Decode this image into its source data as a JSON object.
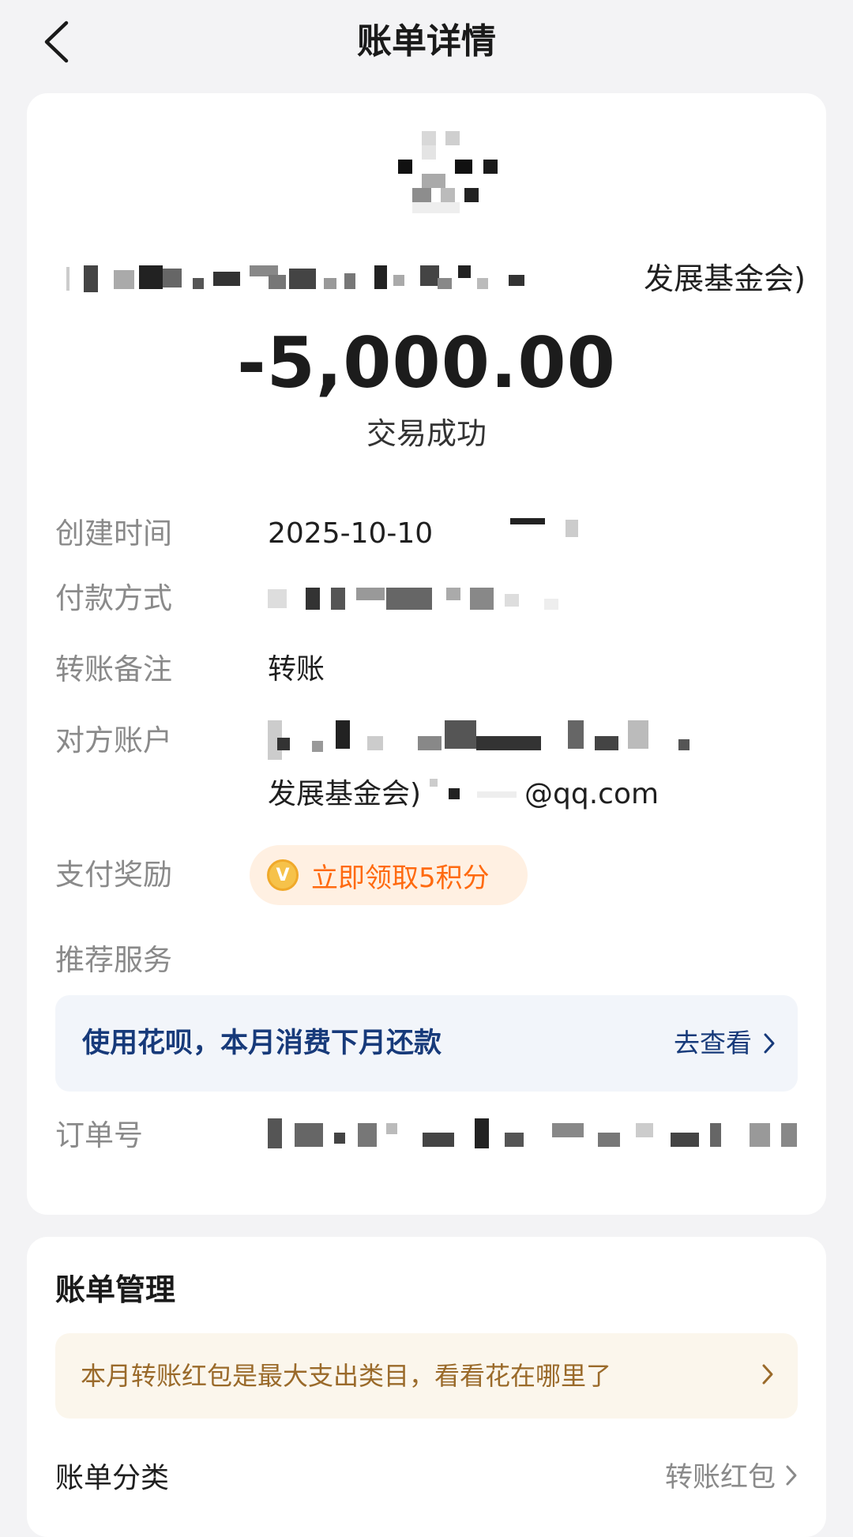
{
  "nav": {
    "back_icon": "chevron-left-icon",
    "title": "账单详情"
  },
  "header": {
    "merchant_visible_tail": "发展基金会)",
    "amount": "-5,000.00",
    "status": "交易成功"
  },
  "details": {
    "created_time": {
      "label": "创建时间",
      "value": "2025-10-10"
    },
    "payment_method": {
      "label": "付款方式"
    },
    "remark": {
      "label": "转账备注",
      "value": "转账"
    },
    "counterparty": {
      "label": "对方账户",
      "value_line2_start": "发展基金会)",
      "value_line2_end": "@qq.com"
    },
    "reward": {
      "label": "支付奖励",
      "button": "立即领取5积分",
      "coin_symbol": "V"
    },
    "recommend": {
      "label": "推荐服务"
    },
    "order_no": {
      "label": "订单号"
    }
  },
  "promo": {
    "text": "使用花呗，本月消费下月还款",
    "link": "去查看"
  },
  "manage": {
    "title": "账单管理",
    "tip": "本月转账红包是最大支出类目，看看花在哪里了",
    "category_label": "账单分类",
    "category_value": "转账红包"
  },
  "colors": {
    "page_bg": "#f3f3f5",
    "promo_blue": "#173a7a",
    "reward_orange": "#ff6a10",
    "tip_brown": "#9a6a2a"
  }
}
